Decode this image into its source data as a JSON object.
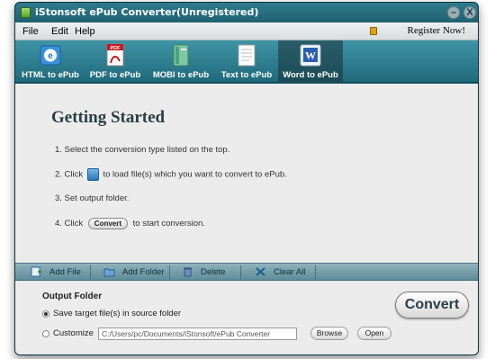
{
  "window": {
    "title": "iStonsoft ePub Converter(Unregistered)",
    "minimize": "–",
    "close": "X"
  },
  "menu": {
    "items": [
      "File",
      "Edit",
      "Help"
    ],
    "register": "Register Now!"
  },
  "toolbar": {
    "items": [
      {
        "label": "HTML to ePub",
        "icon": "html-icon"
      },
      {
        "label": "PDF to ePub",
        "icon": "pdf-icon"
      },
      {
        "label": "MOBI to ePub",
        "icon": "mobi-icon"
      },
      {
        "label": "Text to ePub",
        "icon": "text-icon"
      },
      {
        "label": "Word to ePub",
        "icon": "word-icon",
        "active": true
      }
    ]
  },
  "content": {
    "heading": "Getting Started",
    "step1": "1. Select the conversion type listed on the top.",
    "step2_prefix": "2. Click",
    "step2_suffix": "to load file(s) which you want to convert to ePub.",
    "step3": "3. Set output folder.",
    "step4_prefix": "4. Click",
    "step4_button": "Convert",
    "step4_suffix": "to start conversion."
  },
  "actions": {
    "add_file": "Add File",
    "add_folder": "Add Folder",
    "delete": "Delete",
    "clear_all": "Clear All"
  },
  "output": {
    "title": "Output Folder",
    "option_source": "Save target file(s) in source folder",
    "option_custom": "Customize",
    "path": "C:/Users/pc/Documents/iStonsoft/ePub Converter",
    "browse": "Browse",
    "open": "Open",
    "convert": "Convert"
  },
  "colors": {
    "frame": "#1b5868",
    "toolbar": "#2f7f90",
    "actionbar": "#7fa4ae",
    "content_bg": "#ececec"
  }
}
